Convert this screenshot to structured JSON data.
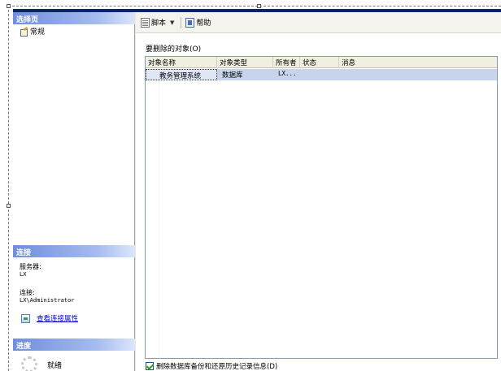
{
  "left_pane": {
    "select_page": {
      "header": "选择页",
      "items": [
        {
          "label": "常规",
          "icon": "general-page-icon"
        }
      ]
    },
    "connection": {
      "header": "连接",
      "server_label": "服务器:",
      "server_value": "LX",
      "login_label": "连接:",
      "login_value": "LX\\Administrator",
      "link_label": "查看连接属性"
    },
    "progress": {
      "header": "进度",
      "status": "就绪"
    }
  },
  "toolbar": {
    "script_label": "脚本",
    "help_label": "帮助"
  },
  "main": {
    "objects_label": "要删除的对象(O)",
    "columns": [
      "对象名称",
      "对象类型",
      "所有者",
      "状态",
      "消息"
    ],
    "rows": [
      {
        "name": "教务管理系统",
        "type": "数据库",
        "owner": "LX...",
        "status": "",
        "message": ""
      }
    ],
    "delete_backup_history_label": "删除数据库备份和还原历史记录信息(D)",
    "delete_backup_history_checked": true
  },
  "colors": {
    "section_header": "#6f8ddb",
    "selected_row": "#c7d4ec",
    "title_bar": "#0a246a"
  }
}
